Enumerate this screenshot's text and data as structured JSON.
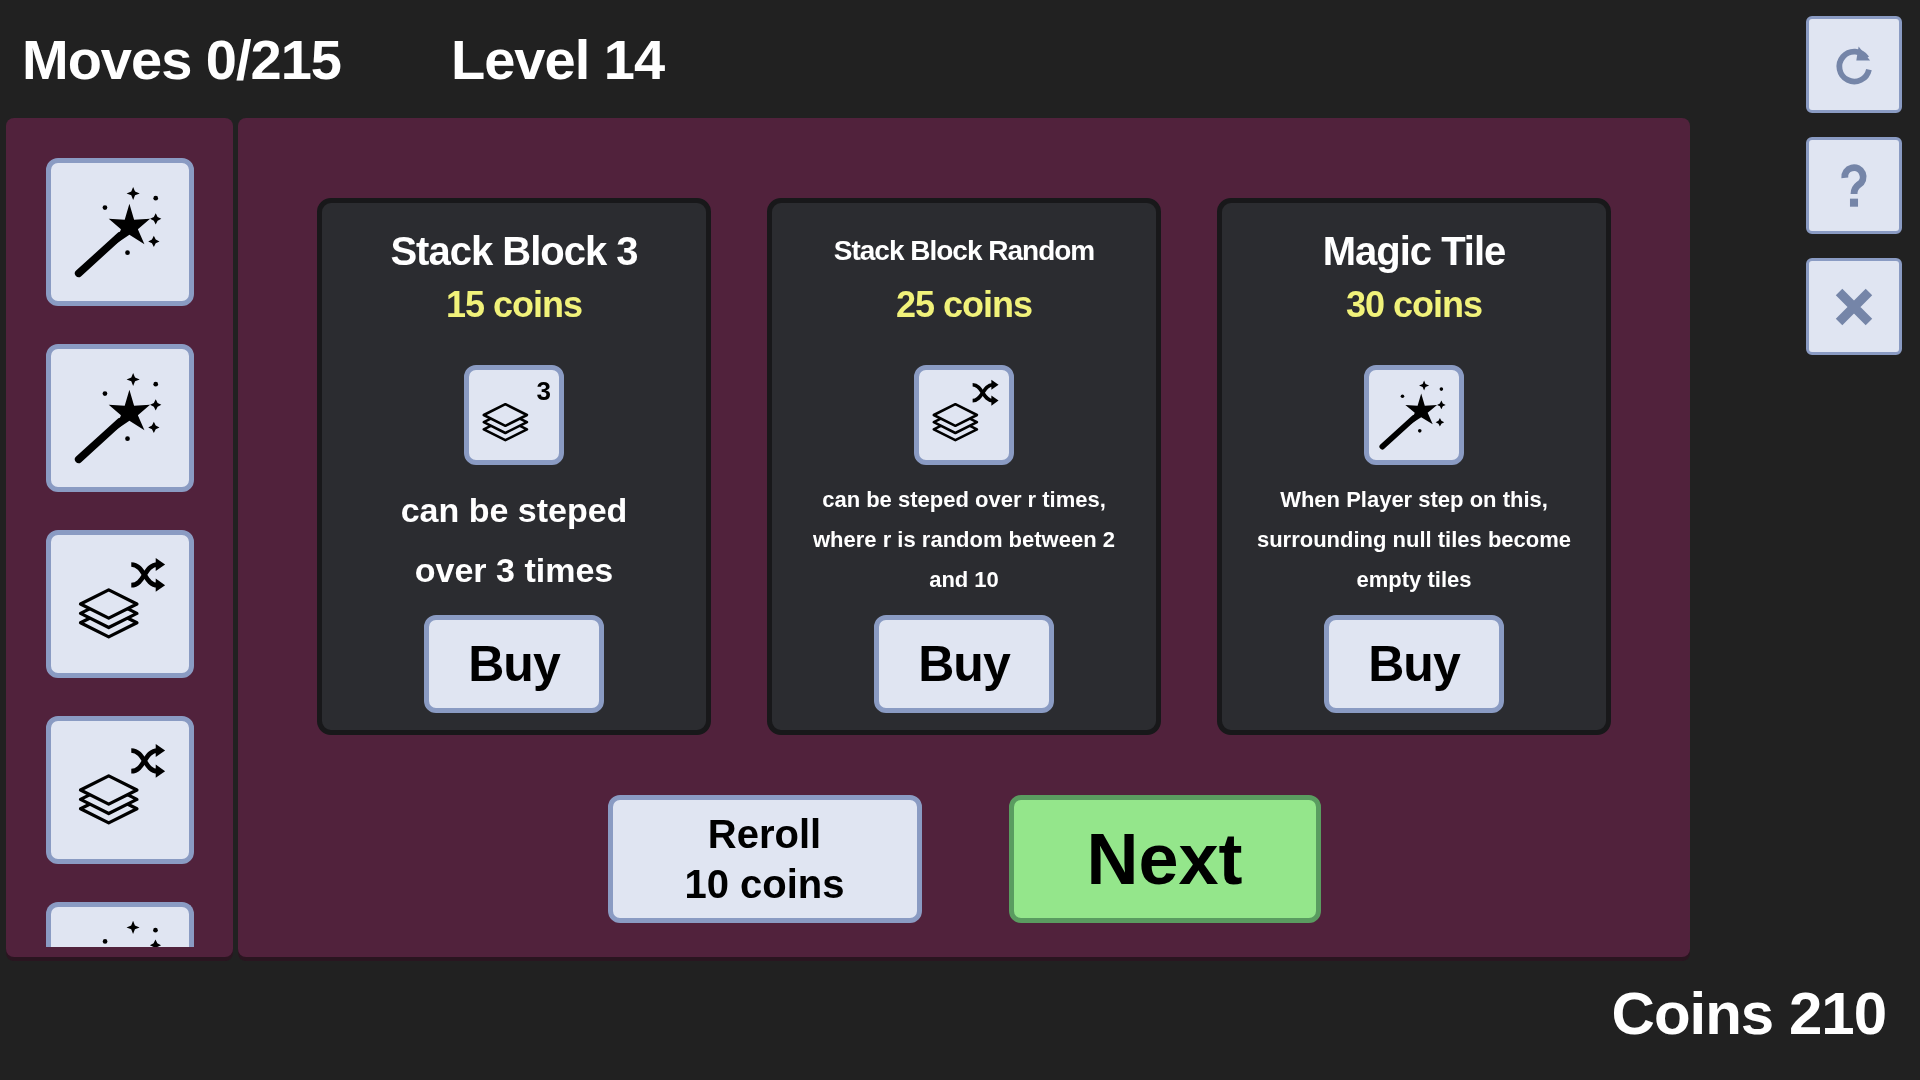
{
  "header": {
    "moves": "Moves 0/215",
    "level": "Level 14"
  },
  "toolbar": [
    {
      "kind": "restart"
    },
    {
      "kind": "help"
    },
    {
      "kind": "close"
    }
  ],
  "inventory": [
    {
      "kind": "wand"
    },
    {
      "kind": "wand"
    },
    {
      "kind": "stack_random"
    },
    {
      "kind": "stack_random"
    },
    {
      "kind": "wand",
      "cut": true
    }
  ],
  "shop": [
    {
      "title": "Stack Block 3",
      "price": "15 coins",
      "icon": {
        "kind": "stack_count",
        "badge": "3"
      },
      "description": "can be steped over 3 times",
      "kind": "short",
      "button": "Buy"
    },
    {
      "title": "Stack Block Random",
      "price": "25 coins",
      "icon": {
        "kind": "stack_random"
      },
      "description": "can be steped over r times, where r is random between 2 and 10",
      "kind": "long",
      "button": "Buy"
    },
    {
      "title": "Magic Tile",
      "price": "30 coins",
      "icon": {
        "kind": "wand"
      },
      "description": "When Player step on this, surrounding null tiles become empty tiles",
      "kind": "long_text",
      "button": "Buy"
    }
  ],
  "reroll": {
    "label": "Reroll",
    "price": "10 coins"
  },
  "next": "Next",
  "coins": "Coins 210"
}
